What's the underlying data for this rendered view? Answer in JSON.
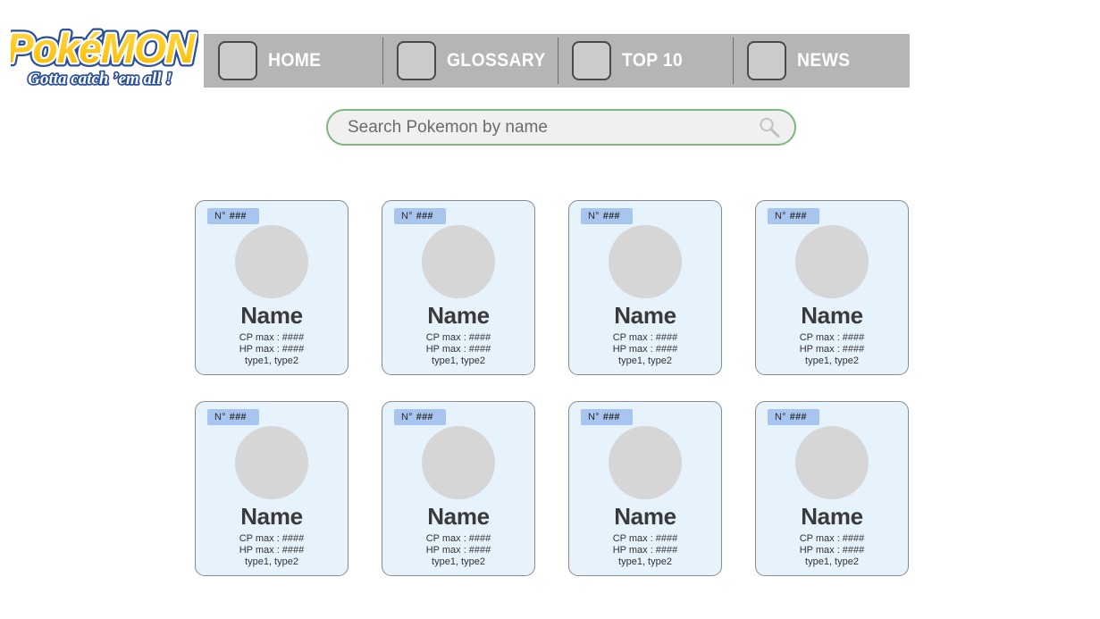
{
  "site": {
    "logo_wordmark": "Pokémon",
    "logo_tagline": "Gotta catch 'em all !",
    "logo_icon": "pokemon-logo"
  },
  "colors": {
    "nav_background": "#b5b5b5",
    "nav_text": "#ffffff",
    "nav_icon_box": "#cbcbcb",
    "search_border": "#7cb87c",
    "search_background": "#f0f0f0",
    "card_background": "#e6f2fc",
    "card_border": "#8a8a8a",
    "badge_background": "#a8c5f0",
    "sprite_placeholder": "#d6d6d6",
    "page_background": "#ffffff"
  },
  "nav": {
    "items": [
      {
        "label": "HOME",
        "icon": "nav-icon-placeholder"
      },
      {
        "label": "GLOSSARY",
        "icon": "nav-icon-placeholder"
      },
      {
        "label": "TOP 10",
        "icon": "nav-icon-placeholder"
      },
      {
        "label": "NEWS",
        "icon": "nav-icon-placeholder"
      }
    ]
  },
  "search": {
    "placeholder": "Search Pokemon by name",
    "value": "",
    "icon": "search-icon"
  },
  "grid": {
    "columns": 4,
    "rows": 2,
    "cards": [
      {
        "number_label": "N°",
        "number_value": "###",
        "name": "Name",
        "cp": "CP max : ####",
        "hp": "HP max : ####",
        "types": "type1, type2",
        "sprite": "sprite-placeholder"
      },
      {
        "number_label": "N°",
        "number_value": "###",
        "name": "Name",
        "cp": "CP max : ####",
        "hp": "HP max : ####",
        "types": "type1, type2",
        "sprite": "sprite-placeholder"
      },
      {
        "number_label": "N°",
        "number_value": "###",
        "name": "Name",
        "cp": "CP max : ####",
        "hp": "HP max : ####",
        "types": "type1, type2",
        "sprite": "sprite-placeholder"
      },
      {
        "number_label": "N°",
        "number_value": "###",
        "name": "Name",
        "cp": "CP max : ####",
        "hp": "HP max : ####",
        "types": "type1, type2",
        "sprite": "sprite-placeholder"
      },
      {
        "number_label": "N°",
        "number_value": "###",
        "name": "Name",
        "cp": "CP max : ####",
        "hp": "HP max : ####",
        "types": "type1, type2",
        "sprite": "sprite-placeholder"
      },
      {
        "number_label": "N°",
        "number_value": "###",
        "name": "Name",
        "cp": "CP max : ####",
        "hp": "HP max : ####",
        "types": "type1, type2",
        "sprite": "sprite-placeholder"
      },
      {
        "number_label": "N°",
        "number_value": "###",
        "name": "Name",
        "cp": "CP max : ####",
        "hp": "HP max : ####",
        "types": "type1, type2",
        "sprite": "sprite-placeholder"
      },
      {
        "number_label": "N°",
        "number_value": "###",
        "name": "Name",
        "cp": "CP max : ####",
        "hp": "HP max : ####",
        "types": "type1, type2",
        "sprite": "sprite-placeholder"
      }
    ]
  }
}
